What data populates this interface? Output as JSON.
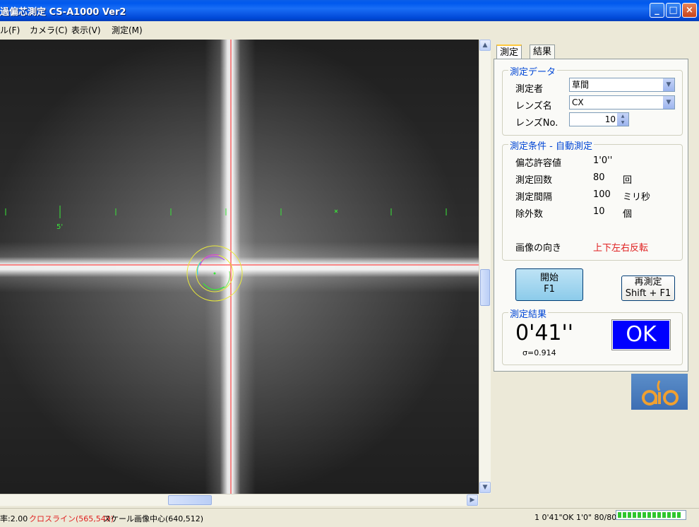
{
  "window": {
    "title": "過偏芯測定 CS-A1000 Ver2",
    "buttons": [
      "_",
      "□",
      "×"
    ]
  },
  "menu": [
    "ル(F)",
    "カメラ(C)",
    "表示(V)",
    "測定(M)"
  ],
  "image": {
    "scale_label": "5'",
    "colors": {
      "crossline": "#FF2020",
      "scale": "#38E838",
      "circle": "#E8E83A"
    }
  },
  "tabs": [
    "測定",
    "結果"
  ],
  "measurement_data": {
    "group_label": "測定データ",
    "operator_label": "測定者",
    "operator_value": "草間",
    "lens_name_label": "レンズ名",
    "lens_name_value": "CX",
    "lens_no_label": "レンズNo.",
    "lens_no_value": "10"
  },
  "conditions": {
    "group_label": "測定条件 - 自動測定",
    "rows": [
      {
        "label": "偏芯許容値",
        "value": "1'0''",
        "unit": ""
      },
      {
        "label": "測定回数",
        "value": "80",
        "unit": "回"
      },
      {
        "label": "測定間隔",
        "value": "100",
        "unit": "ミリ秒"
      },
      {
        "label": "除外数",
        "value": "10",
        "unit": "個"
      }
    ],
    "orientation_label": "画像の向き",
    "orientation_value": "上下左右反転"
  },
  "buttons": {
    "start_line1": "開始",
    "start_line2": "F1",
    "remeasure_line1": "再測定",
    "remeasure_line2": "Shift + F1"
  },
  "result": {
    "group_label": "測定結果",
    "value": "0'41''",
    "sigma": "σ=0.914",
    "judgement": "OK"
  },
  "status": {
    "zoom": "率:2.00",
    "crossline": "クロスライン(565,549)",
    "scale_center": "スケール画像中心(640,512)",
    "summary": "1  0'41\"OK  1'0\"  80/80",
    "progress": 1.0
  }
}
